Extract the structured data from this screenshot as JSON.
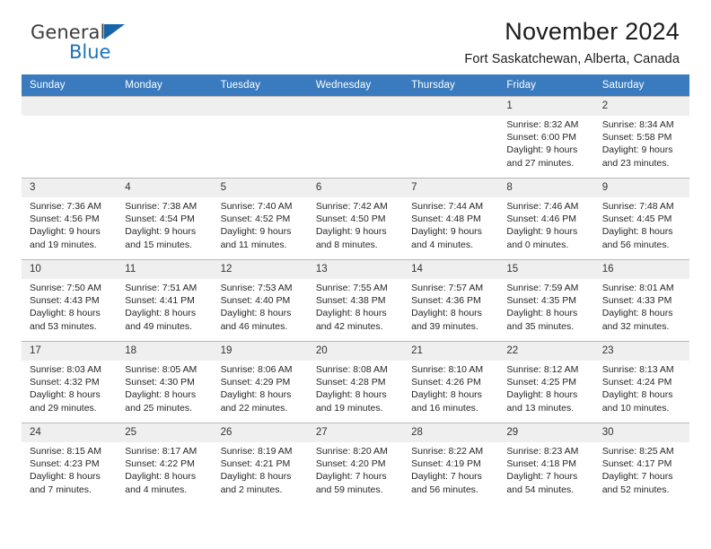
{
  "brand": {
    "name_top": "General",
    "name_bottom": "Blue",
    "triangle_color": "#1565a8",
    "blue_color": "#1b72b8"
  },
  "header": {
    "title": "November 2024",
    "subtitle": "Fort Saskatchewan, Alberta, Canada"
  },
  "theme": {
    "header_bg": "#3a7bbf",
    "header_text": "#ffffff",
    "daynum_bg": "#efefef",
    "cell_border": "#b9b9b9"
  },
  "weekdays": [
    "Sunday",
    "Monday",
    "Tuesday",
    "Wednesday",
    "Thursday",
    "Friday",
    "Saturday"
  ],
  "labels": {
    "sunrise": "Sunrise:",
    "sunset": "Sunset:",
    "daylight": "Daylight:"
  },
  "weeks": [
    [
      {
        "day": "",
        "empty": true
      },
      {
        "day": "",
        "empty": true
      },
      {
        "day": "",
        "empty": true
      },
      {
        "day": "",
        "empty": true
      },
      {
        "day": "",
        "empty": true
      },
      {
        "day": "1",
        "sunrise": "Sunrise: 8:32 AM",
        "sunset": "Sunset: 6:00 PM",
        "daylight_1": "Daylight: 9 hours",
        "daylight_2": "and 27 minutes."
      },
      {
        "day": "2",
        "sunrise": "Sunrise: 8:34 AM",
        "sunset": "Sunset: 5:58 PM",
        "daylight_1": "Daylight: 9 hours",
        "daylight_2": "and 23 minutes."
      }
    ],
    [
      {
        "day": "3",
        "sunrise": "Sunrise: 7:36 AM",
        "sunset": "Sunset: 4:56 PM",
        "daylight_1": "Daylight: 9 hours",
        "daylight_2": "and 19 minutes."
      },
      {
        "day": "4",
        "sunrise": "Sunrise: 7:38 AM",
        "sunset": "Sunset: 4:54 PM",
        "daylight_1": "Daylight: 9 hours",
        "daylight_2": "and 15 minutes."
      },
      {
        "day": "5",
        "sunrise": "Sunrise: 7:40 AM",
        "sunset": "Sunset: 4:52 PM",
        "daylight_1": "Daylight: 9 hours",
        "daylight_2": "and 11 minutes."
      },
      {
        "day": "6",
        "sunrise": "Sunrise: 7:42 AM",
        "sunset": "Sunset: 4:50 PM",
        "daylight_1": "Daylight: 9 hours",
        "daylight_2": "and 8 minutes."
      },
      {
        "day": "7",
        "sunrise": "Sunrise: 7:44 AM",
        "sunset": "Sunset: 4:48 PM",
        "daylight_1": "Daylight: 9 hours",
        "daylight_2": "and 4 minutes."
      },
      {
        "day": "8",
        "sunrise": "Sunrise: 7:46 AM",
        "sunset": "Sunset: 4:46 PM",
        "daylight_1": "Daylight: 9 hours",
        "daylight_2": "and 0 minutes."
      },
      {
        "day": "9",
        "sunrise": "Sunrise: 7:48 AM",
        "sunset": "Sunset: 4:45 PM",
        "daylight_1": "Daylight: 8 hours",
        "daylight_2": "and 56 minutes."
      }
    ],
    [
      {
        "day": "10",
        "sunrise": "Sunrise: 7:50 AM",
        "sunset": "Sunset: 4:43 PM",
        "daylight_1": "Daylight: 8 hours",
        "daylight_2": "and 53 minutes."
      },
      {
        "day": "11",
        "sunrise": "Sunrise: 7:51 AM",
        "sunset": "Sunset: 4:41 PM",
        "daylight_1": "Daylight: 8 hours",
        "daylight_2": "and 49 minutes."
      },
      {
        "day": "12",
        "sunrise": "Sunrise: 7:53 AM",
        "sunset": "Sunset: 4:40 PM",
        "daylight_1": "Daylight: 8 hours",
        "daylight_2": "and 46 minutes."
      },
      {
        "day": "13",
        "sunrise": "Sunrise: 7:55 AM",
        "sunset": "Sunset: 4:38 PM",
        "daylight_1": "Daylight: 8 hours",
        "daylight_2": "and 42 minutes."
      },
      {
        "day": "14",
        "sunrise": "Sunrise: 7:57 AM",
        "sunset": "Sunset: 4:36 PM",
        "daylight_1": "Daylight: 8 hours",
        "daylight_2": "and 39 minutes."
      },
      {
        "day": "15",
        "sunrise": "Sunrise: 7:59 AM",
        "sunset": "Sunset: 4:35 PM",
        "daylight_1": "Daylight: 8 hours",
        "daylight_2": "and 35 minutes."
      },
      {
        "day": "16",
        "sunrise": "Sunrise: 8:01 AM",
        "sunset": "Sunset: 4:33 PM",
        "daylight_1": "Daylight: 8 hours",
        "daylight_2": "and 32 minutes."
      }
    ],
    [
      {
        "day": "17",
        "sunrise": "Sunrise: 8:03 AM",
        "sunset": "Sunset: 4:32 PM",
        "daylight_1": "Daylight: 8 hours",
        "daylight_2": "and 29 minutes."
      },
      {
        "day": "18",
        "sunrise": "Sunrise: 8:05 AM",
        "sunset": "Sunset: 4:30 PM",
        "daylight_1": "Daylight: 8 hours",
        "daylight_2": "and 25 minutes."
      },
      {
        "day": "19",
        "sunrise": "Sunrise: 8:06 AM",
        "sunset": "Sunset: 4:29 PM",
        "daylight_1": "Daylight: 8 hours",
        "daylight_2": "and 22 minutes."
      },
      {
        "day": "20",
        "sunrise": "Sunrise: 8:08 AM",
        "sunset": "Sunset: 4:28 PM",
        "daylight_1": "Daylight: 8 hours",
        "daylight_2": "and 19 minutes."
      },
      {
        "day": "21",
        "sunrise": "Sunrise: 8:10 AM",
        "sunset": "Sunset: 4:26 PM",
        "daylight_1": "Daylight: 8 hours",
        "daylight_2": "and 16 minutes."
      },
      {
        "day": "22",
        "sunrise": "Sunrise: 8:12 AM",
        "sunset": "Sunset: 4:25 PM",
        "daylight_1": "Daylight: 8 hours",
        "daylight_2": "and 13 minutes."
      },
      {
        "day": "23",
        "sunrise": "Sunrise: 8:13 AM",
        "sunset": "Sunset: 4:24 PM",
        "daylight_1": "Daylight: 8 hours",
        "daylight_2": "and 10 minutes."
      }
    ],
    [
      {
        "day": "24",
        "sunrise": "Sunrise: 8:15 AM",
        "sunset": "Sunset: 4:23 PM",
        "daylight_1": "Daylight: 8 hours",
        "daylight_2": "and 7 minutes."
      },
      {
        "day": "25",
        "sunrise": "Sunrise: 8:17 AM",
        "sunset": "Sunset: 4:22 PM",
        "daylight_1": "Daylight: 8 hours",
        "daylight_2": "and 4 minutes."
      },
      {
        "day": "26",
        "sunrise": "Sunrise: 8:19 AM",
        "sunset": "Sunset: 4:21 PM",
        "daylight_1": "Daylight: 8 hours",
        "daylight_2": "and 2 minutes."
      },
      {
        "day": "27",
        "sunrise": "Sunrise: 8:20 AM",
        "sunset": "Sunset: 4:20 PM",
        "daylight_1": "Daylight: 7 hours",
        "daylight_2": "and 59 minutes."
      },
      {
        "day": "28",
        "sunrise": "Sunrise: 8:22 AM",
        "sunset": "Sunset: 4:19 PM",
        "daylight_1": "Daylight: 7 hours",
        "daylight_2": "and 56 minutes."
      },
      {
        "day": "29",
        "sunrise": "Sunrise: 8:23 AM",
        "sunset": "Sunset: 4:18 PM",
        "daylight_1": "Daylight: 7 hours",
        "daylight_2": "and 54 minutes."
      },
      {
        "day": "30",
        "sunrise": "Sunrise: 8:25 AM",
        "sunset": "Sunset: 4:17 PM",
        "daylight_1": "Daylight: 7 hours",
        "daylight_2": "and 52 minutes."
      }
    ]
  ]
}
